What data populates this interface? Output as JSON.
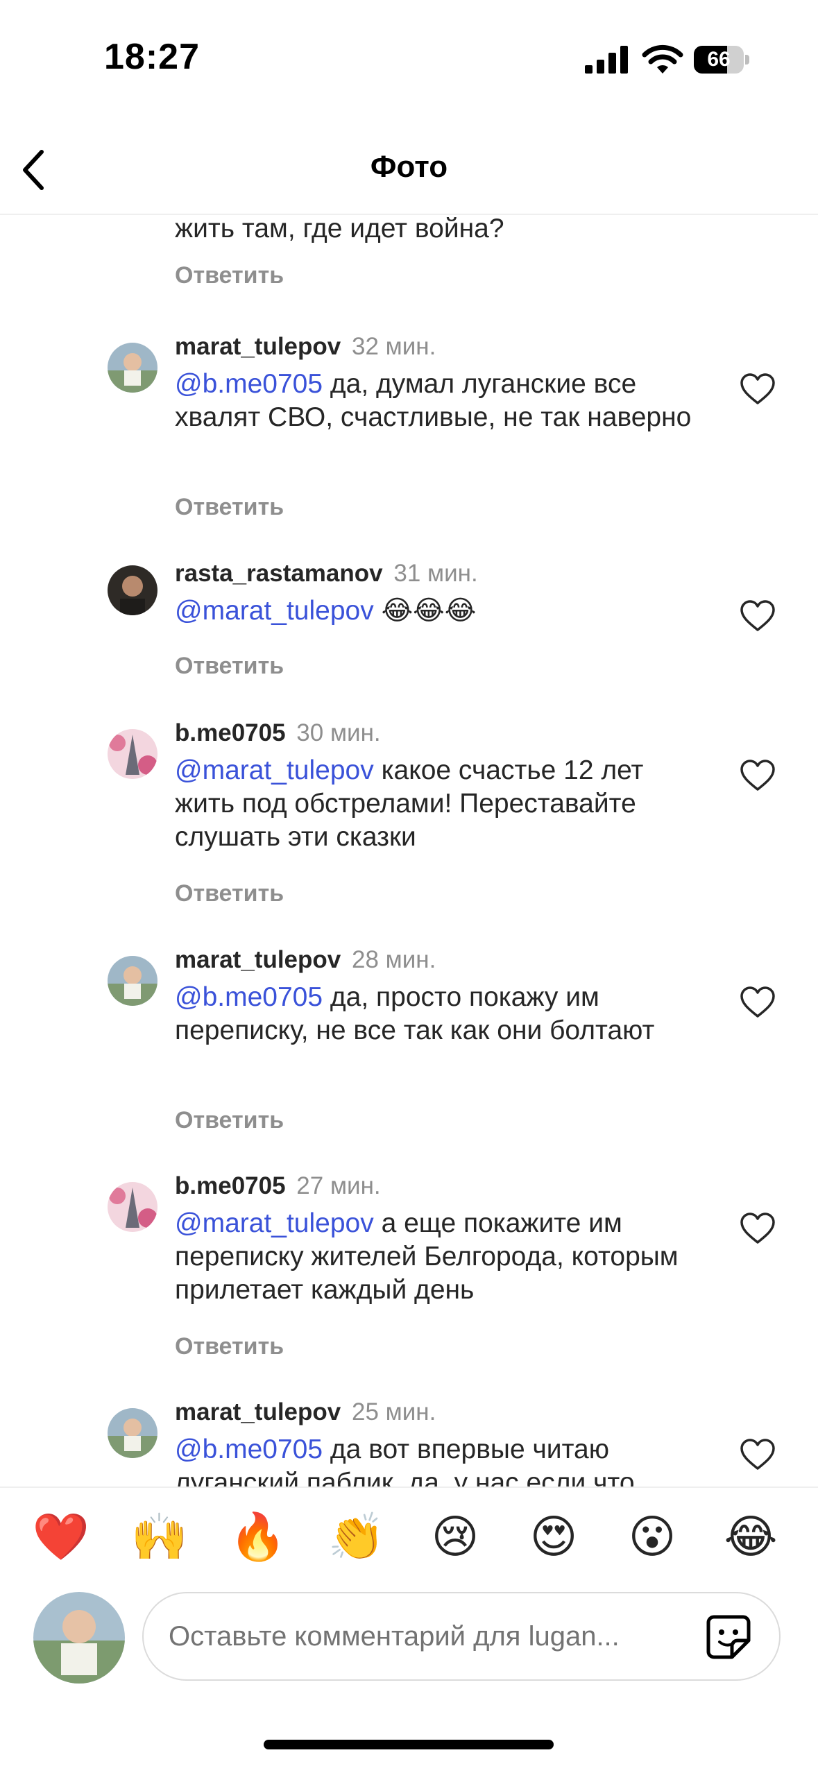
{
  "status": {
    "time": "18:27",
    "battery": "66",
    "battery_level": 0.66
  },
  "header": {
    "title": "Фото"
  },
  "reply_label": "Ответить",
  "top_partial": {
    "text": "жить там, где идет война?"
  },
  "comments": [
    {
      "user": "marat_tulepov",
      "time": "32 мин.",
      "mention": "@b.me0705",
      "text": "да, думал луганские все хвалят СВО, счастливые, не так наверно"
    },
    {
      "user": "rasta_rastamanov",
      "time": "31 мин.",
      "mention": "@marat_tulepov",
      "text": "😂😂😂"
    },
    {
      "user": "b.me0705",
      "time": "30 мин.",
      "mention": "@marat_tulepov",
      "text": "какое счастье 12 лет жить под обстрелами! Переставайте слушать эти сказки"
    },
    {
      "user": "marat_tulepov",
      "time": "28 мин.",
      "mention": "@b.me0705",
      "text": "да, просто покажу им переписку, не все так как они болтают"
    },
    {
      "user": "b.me0705",
      "time": "27 мин.",
      "mention": "@marat_tulepov",
      "text": "а еще покажите им переписку жителей Белгорода, которым прилетает каждый день"
    },
    {
      "user": "marat_tulepov",
      "time": "25 мин.",
      "mention": "@b.me0705",
      "text": "да вот впервые читаю луганский паблик, да, у нас если что"
    }
  ],
  "reactions": [
    "❤️",
    "🙌",
    "🔥",
    "👏",
    "😢",
    "😍",
    "😮",
    "😂"
  ],
  "composer": {
    "placeholder": "Оставьте комментарий для lugan..."
  },
  "colors": {
    "mention": "#3a52d9",
    "muted": "#8e8e8e",
    "text": "#262626"
  }
}
